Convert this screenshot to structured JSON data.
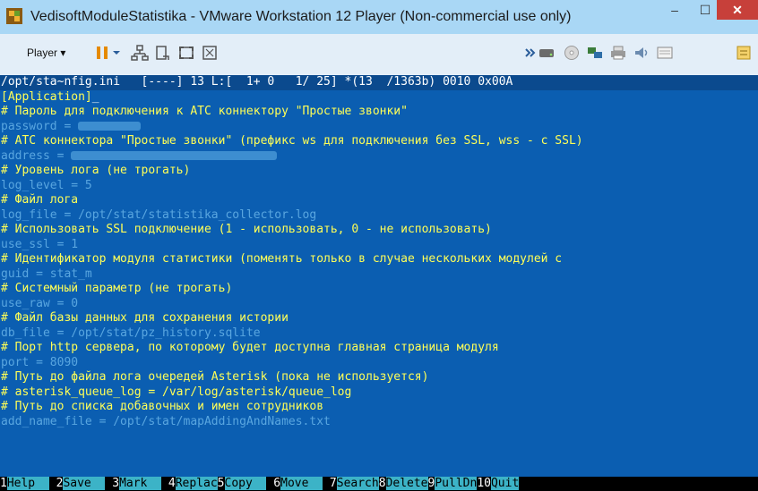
{
  "window": {
    "title": "VedisoftModuleStatistika - VMware Workstation 12 Player (Non-commercial use only)",
    "minimize": "–",
    "maximize": "☐",
    "close": "✕"
  },
  "toolbar": {
    "player_menu": "Player ▾"
  },
  "editor": {
    "status_line": "/opt/sta~nfig.ini   [----] 13 L:[  1+ 0   1/ 25] *(13  /1363b) 0010 0x00A",
    "lines": [
      {
        "type": "section",
        "text": "[Application]"
      },
      {
        "type": "comment",
        "text": "# Пароль для подключения к АТС коннектору \"Простые звонки\""
      },
      {
        "type": "kv",
        "key": "password = ",
        "value": ""
      },
      {
        "type": "comment",
        "text": "# АТС коннектора \"Простые звонки\" (префикс ws для подключения без SSL, wss - с SSL)"
      },
      {
        "type": "kv",
        "key": "address = ",
        "value": ""
      },
      {
        "type": "comment",
        "text": "# Уровень лога (не трогать)"
      },
      {
        "type": "kv",
        "key": "log_level = ",
        "value": "5"
      },
      {
        "type": "comment",
        "text": "# Файл лога"
      },
      {
        "type": "kv",
        "key": "log_file = ",
        "value": "/opt/stat/statistika_collector.log"
      },
      {
        "type": "comment",
        "text": "# Использовать SSL подключение (1 - использовать, 0 - не использовать)"
      },
      {
        "type": "kv",
        "key": "use_ssl = ",
        "value": "1"
      },
      {
        "type": "comment",
        "text": "# Идентификатор модуля статистики (поменять только в случае нескольких модулей с"
      },
      {
        "type": "kv",
        "key": "guid = ",
        "value": "stat_m"
      },
      {
        "type": "comment",
        "text": "# Системный параметр (не трогать)"
      },
      {
        "type": "kv",
        "key": "use_raw = ",
        "value": "0"
      },
      {
        "type": "comment",
        "text": "# Файл базы данных для сохранения истории"
      },
      {
        "type": "kv",
        "key": "db_file = ",
        "value": "/opt/stat/pz_history.sqlite"
      },
      {
        "type": "comment",
        "text": "# Порт http сервера, по которому будет доступна главная страница модуля"
      },
      {
        "type": "kv",
        "key": "port = ",
        "value": "8090"
      },
      {
        "type": "comment",
        "text": "# Путь до файла лога очередей Asterisk (пока не используется)"
      },
      {
        "type": "comment",
        "text": "# asterisk_queue_log = /var/log/asterisk/queue_log"
      },
      {
        "type": "comment",
        "text": "# Путь до списка добавочных и имен сотрудников"
      },
      {
        "type": "kv",
        "key": "add_name_file = ",
        "value": "/opt/stat/mapAddingAndNames.txt"
      }
    ]
  },
  "fnkeys": [
    {
      "num": "1",
      "label": "Help  "
    },
    {
      "num": " 2",
      "label": "Save  "
    },
    {
      "num": " 3",
      "label": "Mark  "
    },
    {
      "num": " 4",
      "label": "Replac"
    },
    {
      "num": "5",
      "label": "Copy  "
    },
    {
      "num": " 6",
      "label": "Move  "
    },
    {
      "num": " 7",
      "label": "Search"
    },
    {
      "num": "8",
      "label": "Delete"
    },
    {
      "num": "9",
      "label": "PullDn"
    },
    {
      "num": "10",
      "label": "Quit"
    }
  ]
}
